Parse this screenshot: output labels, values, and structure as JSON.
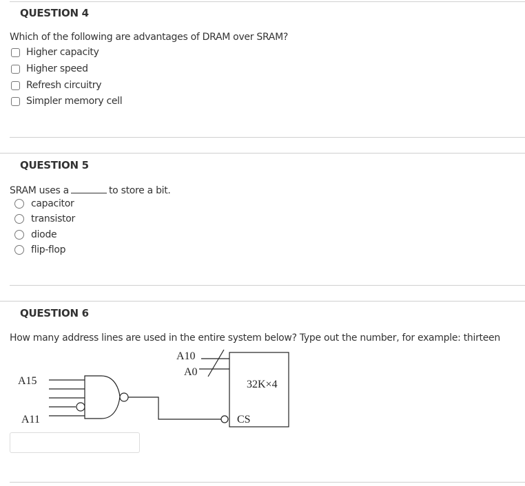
{
  "questions": [
    {
      "title": "QUESTION 4",
      "text": "Which of the following are advantages of DRAM over SRAM?",
      "type": "checkbox",
      "options": [
        "Higher capacity",
        "Higher speed",
        "Refresh circuitry",
        "Simpler memory cell"
      ]
    },
    {
      "title": "QUESTION 5",
      "text_before": "SRAM uses a",
      "text_after": "to store a bit.",
      "type": "radio",
      "options": [
        "capacitor",
        "transistor",
        "diode",
        "flip-flop"
      ]
    },
    {
      "title": "QUESTION 6",
      "text": "How many address lines are used in the entire system below? Type out the number, for example: thirteen",
      "type": "text",
      "answer_value": "",
      "diagram": {
        "gate_input_top_label": "A15",
        "gate_input_bottom_label": "A11",
        "bus_top_label": "A10",
        "bus_bottom_label": "A0",
        "chip_label": "32K×4",
        "chip_select_label": "CS"
      }
    }
  ]
}
